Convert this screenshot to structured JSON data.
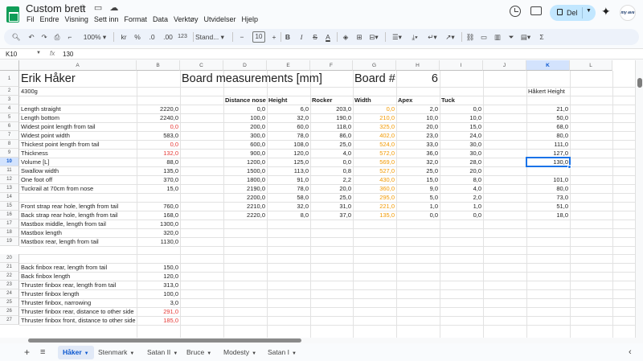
{
  "app": {
    "title": "Custom brett",
    "title_icons": "☆ ▭ ☁",
    "menus": [
      "Fil",
      "Endre",
      "Visning",
      "Sett inn",
      "Format",
      "Data",
      "Verktøy",
      "Utvidelser",
      "Hjelp"
    ],
    "share_label": "Del",
    "avatar_text": "my ave"
  },
  "toolbar": {
    "zoom": "100%",
    "kr": "kr",
    "percent": "%",
    "dec_less": ".0",
    "dec_more": ".00",
    "num_format": "123",
    "font": "Stand...",
    "font_size": "10",
    "bold": "B",
    "italic": "I",
    "strike": "S",
    "text_color": "A",
    "sum": "Σ"
  },
  "formula_bar": {
    "cell_ref": "K10",
    "fx": "fx",
    "value": "130"
  },
  "grid": {
    "columns": [
      "A",
      "B",
      "C",
      "D",
      "E",
      "F",
      "G",
      "H",
      "I",
      "J",
      "K",
      "L"
    ],
    "active_column": "K",
    "rows": [
      "1",
      "2",
      "3",
      "4",
      "5",
      "6",
      "7",
      "8",
      "9",
      "10",
      "11",
      "12",
      "13",
      "14",
      "15",
      "16",
      "17",
      "18",
      "19",
      "20",
      "21",
      "22",
      "23",
      "24",
      "25",
      "26",
      "27"
    ],
    "active_row": "10",
    "header": {
      "name": "Erik Håker",
      "board_measurements": "Board measurements [mm]",
      "board_number_label": "Board #",
      "board_number": "6",
      "weight": "4300g",
      "hakert_height": "Håkert Height"
    },
    "measure_headers": [
      "Distance nose",
      "Height",
      "Rocker",
      "Width",
      "Apex",
      "Tuck"
    ],
    "params": [
      {
        "label": "Length straight",
        "value": "2220,0",
        "color": "default"
      },
      {
        "label": "Length bottom",
        "value": "2240,0",
        "color": "default"
      },
      {
        "label": "Widest point length from tail",
        "value": "0,0",
        "color": "red"
      },
      {
        "label": "Widest point width",
        "value": "583,0",
        "color": "default"
      },
      {
        "label": "Thickest point length from tail",
        "value": "0,0",
        "color": "red"
      },
      {
        "label": "Thickness",
        "value": "132,0",
        "color": "red"
      },
      {
        "label": "Volume [L]",
        "value": "88,0",
        "color": "default"
      },
      {
        "label": "Swallow width",
        "value": "135,0",
        "color": "default"
      },
      {
        "label": "One foot off",
        "value": "370,0",
        "color": "default"
      },
      {
        "label": "Tuckrail at 70cm from nose",
        "value": "15,0",
        "color": "default"
      },
      {
        "label": "",
        "value": "",
        "color": "default"
      },
      {
        "label": "Front strap rear hole, length from tail",
        "value": "760,0",
        "color": "default"
      },
      {
        "label": "Back strap rear hole, length from tail",
        "value": "168,0",
        "color": "default"
      },
      {
        "label": "Mastbox middle, length from tail",
        "value": "1300,0",
        "color": "default"
      },
      {
        "label": "Mastbox length",
        "value": "320,0",
        "color": "default"
      },
      {
        "label": "Mastbox rear, length from tail",
        "value": "1130,0",
        "color": "default"
      },
      {
        "label": "",
        "value": "",
        "color": "default"
      },
      {
        "label": "Back finbox rear, length from tail",
        "value": "150,0",
        "color": "default"
      },
      {
        "label": "Back finbox length",
        "value": "120,0",
        "color": "default"
      },
      {
        "label": "Thruster finbox rear, length from tail",
        "value": "313,0",
        "color": "default"
      },
      {
        "label": "Thruster finbox length",
        "value": "100,0",
        "color": "default"
      },
      {
        "label": "Thruster finbox, narrowing",
        "value": "3,0",
        "color": "default"
      },
      {
        "label": "Thruster finbox rear, distance to other side",
        "value": "291,0",
        "color": "red"
      },
      {
        "label": "Thruster finbox front, distance to other side",
        "value": "185,0",
        "color": "red"
      }
    ],
    "measurements": [
      [
        "0,0",
        "6,0",
        "203,0",
        "0,0",
        "2,0",
        "0,0",
        "21,0"
      ],
      [
        "100,0",
        "32,0",
        "190,0",
        "210,0",
        "10,0",
        "10,0",
        "50,0"
      ],
      [
        "200,0",
        "60,0",
        "118,0",
        "325,0",
        "20,0",
        "15,0",
        "68,0"
      ],
      [
        "300,0",
        "78,0",
        "86,0",
        "402,0",
        "23,0",
        "24,0",
        "80,0"
      ],
      [
        "600,0",
        "108,0",
        "25,0",
        "524,0",
        "33,0",
        "30,0",
        "111,0"
      ],
      [
        "900,0",
        "120,0",
        "4,0",
        "572,0",
        "36,0",
        "30,0",
        "127,0"
      ],
      [
        "1200,0",
        "125,0",
        "0,0",
        "569,0",
        "32,0",
        "28,0",
        "130,0"
      ],
      [
        "1500,0",
        "113,0",
        "0,8",
        "527,0",
        "25,0",
        "20,0",
        ""
      ],
      [
        "1800,0",
        "91,0",
        "2,2",
        "430,0",
        "15,0",
        "8,0",
        "101,0"
      ],
      [
        "2190,0",
        "78,0",
        "20,0",
        "360,0",
        "9,0",
        "4,0",
        "80,0"
      ],
      [
        "2200,0",
        "58,0",
        "25,0",
        "295,0",
        "5,0",
        "2,0",
        "73,0"
      ],
      [
        "2210,0",
        "32,0",
        "31,0",
        "221,0",
        "1,0",
        "1,0",
        "51,0"
      ],
      [
        "2220,0",
        "8,0",
        "37,0",
        "135,0",
        "0,0",
        "0,0",
        "18,0"
      ]
    ]
  },
  "sheets": {
    "tabs": [
      "Håker",
      "Stenmark",
      "Satan II",
      "Bruce",
      "Modesty",
      "Satan I"
    ],
    "active": "Håker"
  },
  "colors": {
    "accent": "#0b57d0",
    "red_value": "#e53935",
    "orange_value": "#f29900",
    "selection": "#1a73e8"
  }
}
